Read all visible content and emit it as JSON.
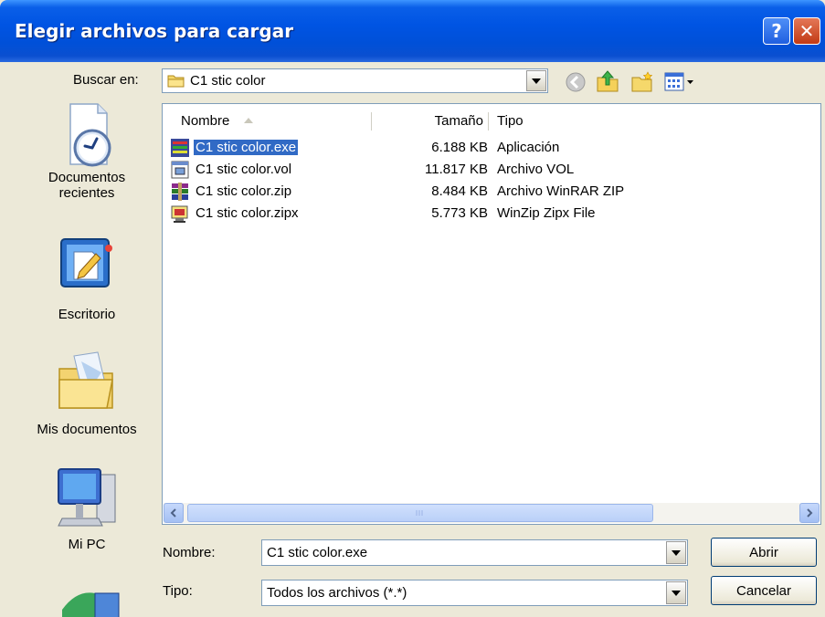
{
  "window": {
    "title": "Elegir archivos para cargar",
    "help_glyph": "?",
    "close_glyph": "✕"
  },
  "lookin": {
    "label": "Buscar en:",
    "value": "C1 stic color"
  },
  "places": [
    {
      "label": "Documentos recientes",
      "icon": "recent-documents-icon"
    },
    {
      "label": "Escritorio",
      "icon": "desktop-icon"
    },
    {
      "label": "Mis documentos",
      "icon": "my-documents-icon"
    },
    {
      "label": "Mi PC",
      "icon": "my-computer-icon"
    }
  ],
  "columns": {
    "name": "Nombre",
    "size": "Tamaño",
    "type": "Tipo"
  },
  "files": [
    {
      "name": "C1 stic color.exe",
      "size": "6.188 KB",
      "type": "Aplicación",
      "icon": "exe-icon",
      "selected": true
    },
    {
      "name": "C1 stic color.vol",
      "size": "11.817 KB",
      "type": "Archivo VOL",
      "icon": "vol-icon",
      "selected": false
    },
    {
      "name": "C1 stic color.zip",
      "size": "8.484 KB",
      "type": "Archivo WinRAR ZIP",
      "icon": "winrar-icon",
      "selected": false
    },
    {
      "name": "C1 stic color.zipx",
      "size": "5.773 KB",
      "type": "WinZip Zipx File",
      "icon": "winzip-icon",
      "selected": false
    }
  ],
  "filename": {
    "label": "Nombre:",
    "value": "C1 stic color.exe"
  },
  "filetype": {
    "label": "Tipo:",
    "value": "Todos los archivos (*.*)"
  },
  "buttons": {
    "open": "Abrir",
    "cancel": "Cancelar"
  },
  "colors": {
    "titlebar": "#0054e3",
    "selection": "#316ac5",
    "dialog_bg": "#ECE9D8"
  }
}
